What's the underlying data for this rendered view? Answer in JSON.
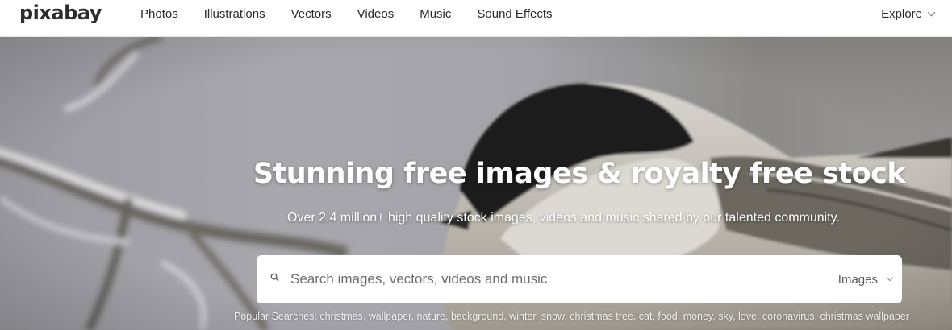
{
  "header": {
    "logo": "pixabay",
    "nav": [
      "Photos",
      "Illustrations",
      "Vectors",
      "Videos",
      "Music",
      "Sound Effects"
    ],
    "explore_label": "Explore"
  },
  "hero": {
    "title": "Stunning free images & royalty free stock",
    "subtitle": "Over 2.4 million+ high quality stock images, videos and music shared by our talented community.",
    "search": {
      "placeholder": "Search images, vectors, videos and music",
      "value": "",
      "type_label": "Images"
    },
    "popular_label": "Popular Searches:",
    "popular_terms": [
      "christmas",
      "wallpaper",
      "nature",
      "background",
      "winter",
      "snow",
      "christmas tree",
      "cat",
      "food",
      "money",
      "sky",
      "love",
      "coronavirus",
      "christmas wallpaper"
    ]
  },
  "colors": {
    "text": "#2a2a2a",
    "hero_bg": "#a3a3a9",
    "white": "#ffffff"
  },
  "icons": {
    "search": "search-icon",
    "chevron": "chevron-down-icon"
  }
}
